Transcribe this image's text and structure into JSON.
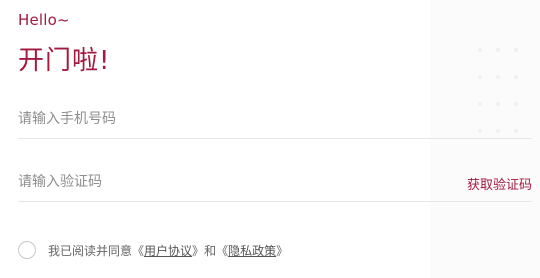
{
  "header": {
    "greeting": "Hello~",
    "title": "开门啦!"
  },
  "form": {
    "phone_placeholder": "请输入手机号码",
    "phone_value": "",
    "code_placeholder": "请输入验证码",
    "code_value": "",
    "get_code_label": "获取验证码"
  },
  "agreement": {
    "checked": false,
    "prefix": "我已阅读并同意",
    "open_quote_1": "《",
    "user_agreement": "用户协议",
    "close_quote_1": "》",
    "and": "和",
    "open_quote_2": "《",
    "privacy_policy": "隐私政策",
    "close_quote_2": "》"
  },
  "colors": {
    "accent": "#a3193f",
    "placeholder": "#8e8e8e",
    "divider": "#e6e6e6"
  }
}
